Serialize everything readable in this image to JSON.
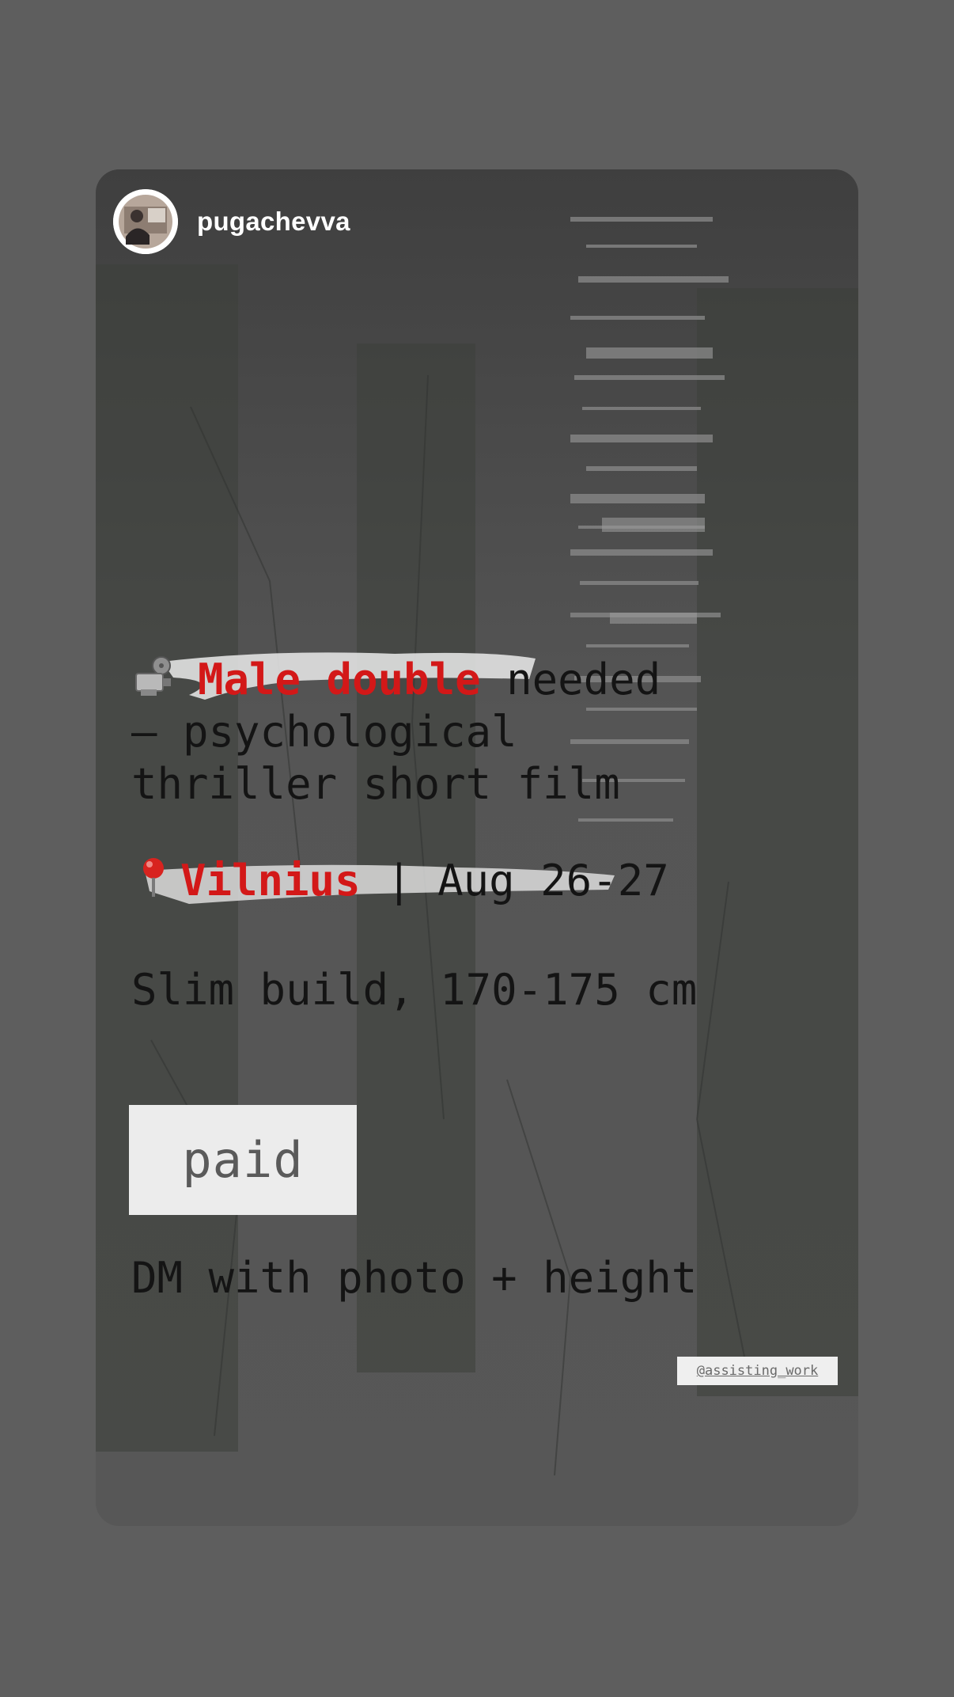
{
  "story": {
    "username": "pugachevva",
    "avatar_icon": "profile-avatar",
    "mention": "@assisting_work"
  },
  "content": {
    "line1": {
      "emoji": "film-projector-icon",
      "highlight": "Male double",
      "rest": " needed"
    },
    "line2": "— psychological",
    "line3": "thriller short film",
    "location": {
      "emoji": "round-pushpin-icon",
      "city": "Vilnius",
      "separator": " | ",
      "dates": "Aug 26-27"
    },
    "build": "Slim build, 170-175 cm",
    "paid": "paid",
    "cta": "DM with photo + height"
  },
  "colors": {
    "page_background": "#5e5e5e",
    "accent_red": "#d31818",
    "text_dark": "#141414",
    "highlight_white": "#e8e8e8"
  }
}
